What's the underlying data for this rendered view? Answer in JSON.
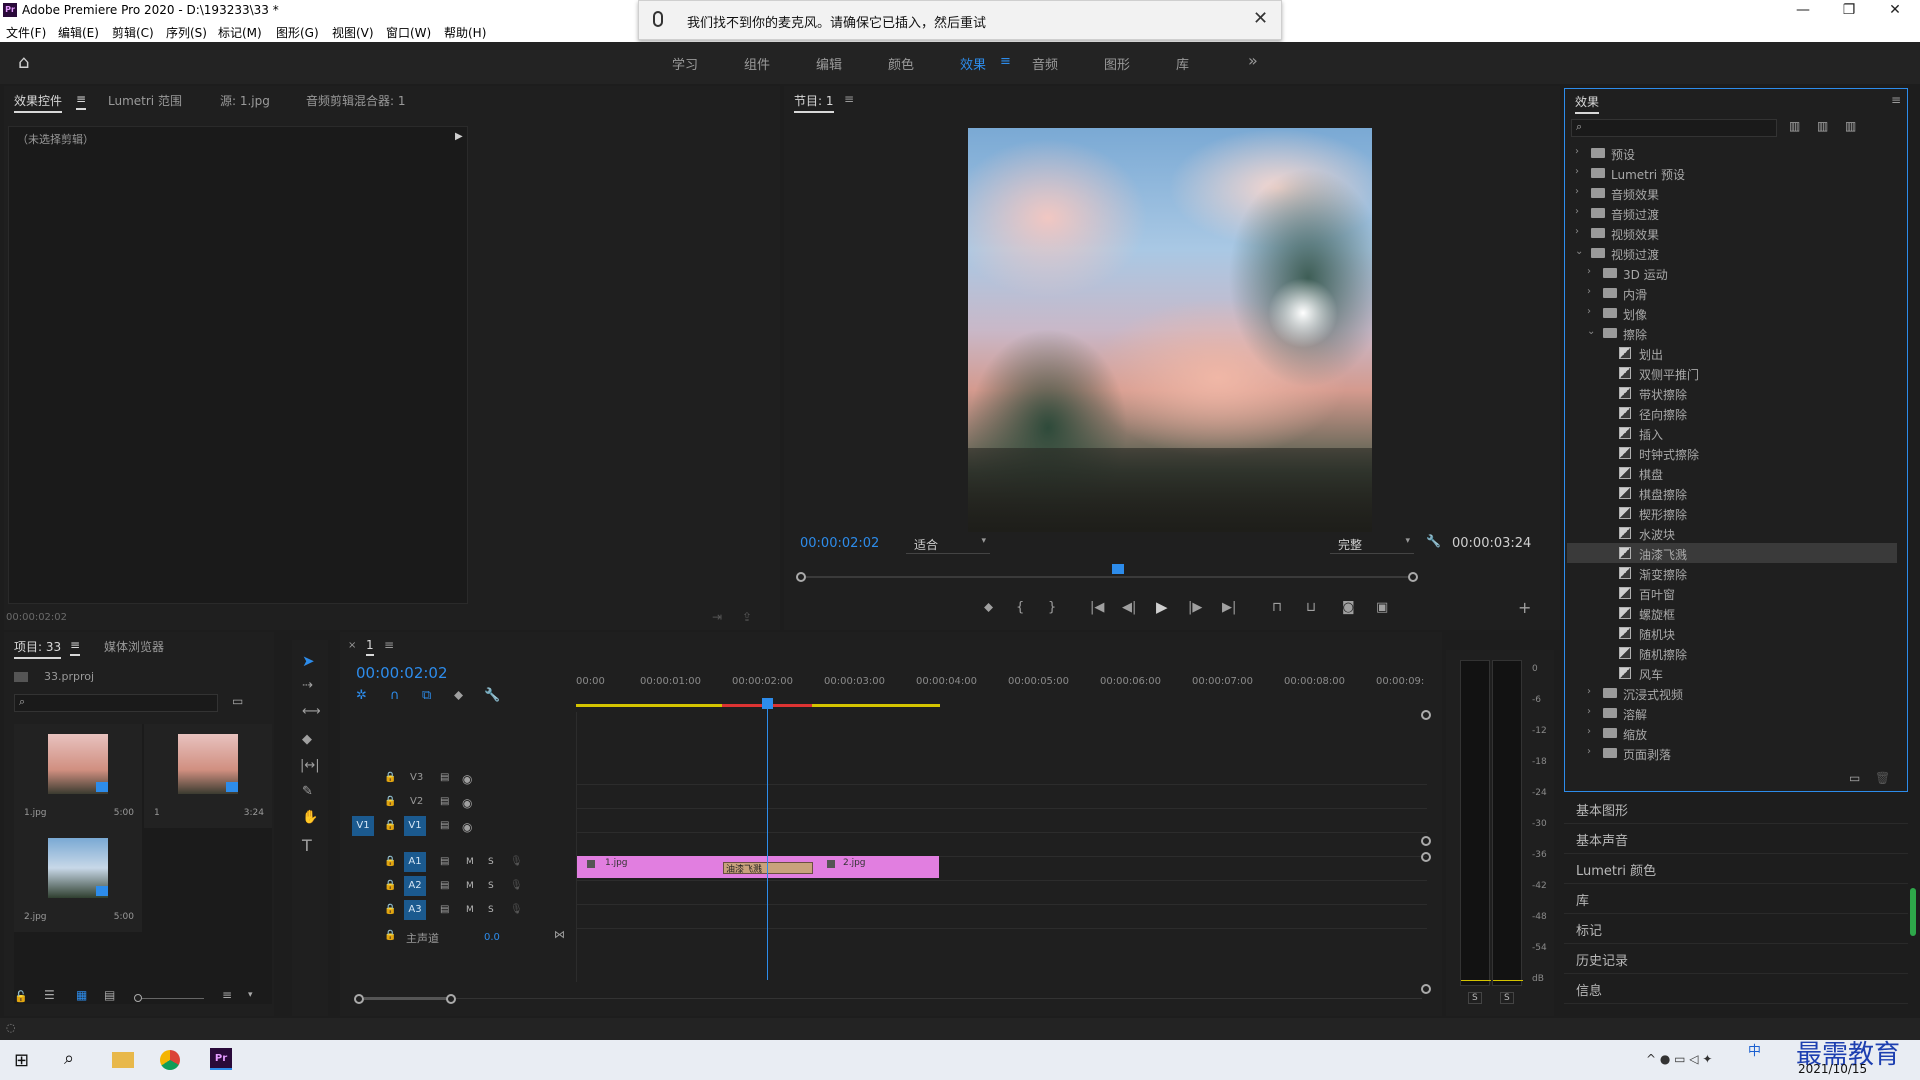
{
  "window": {
    "title": "Adobe Premiere Pro 2020 - D:\\193233\\33 *",
    "minimize": "—",
    "maximize": "❐",
    "close": "✕"
  },
  "menu": [
    "文件(F)",
    "编辑(E)",
    "剪辑(C)",
    "序列(S)",
    "标记(M)",
    "图形(G)",
    "视图(V)",
    "窗口(W)",
    "帮助(H)"
  ],
  "notification": {
    "text": "我们找不到你的麦克风。请确保它已插入，然后重试"
  },
  "workspaces": {
    "items": [
      "学习",
      "组件",
      "编辑",
      "颜色",
      "效果",
      "音频",
      "图形",
      "库"
    ],
    "active": "效果",
    "more": "»"
  },
  "source_panel": {
    "tabs": [
      "效果控件",
      "Lumetri 范围",
      "源: 1.jpg",
      "音频剪辑混合器: 1"
    ],
    "no_clip": "（未选择剪辑）",
    "timecode": "00:00:02:02"
  },
  "program": {
    "tab": "节目: 1",
    "timecode": "00:00:02:02",
    "fit": "适合",
    "quality": "完整",
    "duration": "00:00:03:24",
    "playhead_fraction": 0.52
  },
  "project": {
    "tabs": [
      "项目: 33",
      "媒体浏览器"
    ],
    "file": "33.prproj",
    "items": [
      {
        "name": "1.jpg",
        "duration": "5:00"
      },
      {
        "name": "1",
        "duration": "3:24"
      },
      {
        "name": "2.jpg",
        "duration": "5:00"
      }
    ]
  },
  "timeline": {
    "tab": "1",
    "timecode": "00:00:02:02",
    "ruler": [
      "00:00",
      "00:00:01:00",
      "00:00:02:00",
      "00:00:03:00",
      "00:00:04:00",
      "00:00:05:00",
      "00:00:06:00",
      "00:00:07:00",
      "00:00:08:00",
      "00:00:09:"
    ],
    "video_tracks": [
      "V3",
      "V2",
      "V1"
    ],
    "audio_tracks": [
      "A1",
      "A2",
      "A3"
    ],
    "source_patch": "V1",
    "master": {
      "label": "主声道",
      "value": "0.0"
    },
    "clips": {
      "clip1": "1.jpg",
      "transition": "油漆飞溅",
      "clip2": "2.jpg"
    },
    "m": "M",
    "s": "S"
  },
  "meter": {
    "scale": [
      "0",
      "-6",
      "-12",
      "-18",
      "-24",
      "-30",
      "-36",
      "-42",
      "-48",
      "-54",
      "dB"
    ],
    "solo": [
      "S",
      "S"
    ]
  },
  "effects": {
    "title": "效果",
    "tree": [
      {
        "label": "预设",
        "level": 0,
        "type": "folder-preset",
        "open": false
      },
      {
        "label": "Lumetri 预设",
        "level": 0,
        "type": "folder-preset",
        "open": false
      },
      {
        "label": "音频效果",
        "level": 0,
        "type": "folder",
        "open": false
      },
      {
        "label": "音频过渡",
        "level": 0,
        "type": "folder",
        "open": false
      },
      {
        "label": "视频效果",
        "level": 0,
        "type": "folder",
        "open": false
      },
      {
        "label": "视频过渡",
        "level": 0,
        "type": "folder",
        "open": true
      },
      {
        "label": "3D 运动",
        "level": 1,
        "type": "folder",
        "open": false
      },
      {
        "label": "内滑",
        "level": 1,
        "type": "folder",
        "open": false
      },
      {
        "label": "划像",
        "level": 1,
        "type": "folder",
        "open": false
      },
      {
        "label": "擦除",
        "level": 1,
        "type": "folder",
        "open": true
      },
      {
        "label": "划出",
        "level": 2,
        "type": "effect"
      },
      {
        "label": "双侧平推门",
        "level": 2,
        "type": "effect"
      },
      {
        "label": "带状擦除",
        "level": 2,
        "type": "effect"
      },
      {
        "label": "径向擦除",
        "level": 2,
        "type": "effect"
      },
      {
        "label": "插入",
        "level": 2,
        "type": "effect"
      },
      {
        "label": "时钟式擦除",
        "level": 2,
        "type": "effect"
      },
      {
        "label": "棋盘",
        "level": 2,
        "type": "effect"
      },
      {
        "label": "棋盘擦除",
        "level": 2,
        "type": "effect"
      },
      {
        "label": "楔形擦除",
        "level": 2,
        "type": "effect"
      },
      {
        "label": "水波块",
        "level": 2,
        "type": "effect"
      },
      {
        "label": "油漆飞溅",
        "level": 2,
        "type": "effect",
        "selected": true
      },
      {
        "label": "渐变擦除",
        "level": 2,
        "type": "effect"
      },
      {
        "label": "百叶窗",
        "level": 2,
        "type": "effect"
      },
      {
        "label": "螺旋框",
        "level": 2,
        "type": "effect"
      },
      {
        "label": "随机块",
        "level": 2,
        "type": "effect"
      },
      {
        "label": "随机擦除",
        "level": 2,
        "type": "effect"
      },
      {
        "label": "风车",
        "level": 2,
        "type": "effect"
      },
      {
        "label": "沉浸式视频",
        "level": 1,
        "type": "folder",
        "open": false
      },
      {
        "label": "溶解",
        "level": 1,
        "type": "folder",
        "open": false
      },
      {
        "label": "缩放",
        "level": 1,
        "type": "folder",
        "open": false
      },
      {
        "label": "页面剥落",
        "level": 1,
        "type": "folder",
        "open": false
      }
    ]
  },
  "side_panels": [
    "基本图形",
    "基本声音",
    "Lumetri 颜色",
    "库",
    "标记",
    "历史记录",
    "信息"
  ],
  "taskbar": {
    "date": "2021/10/15",
    "watermark": "最需教育",
    "ime": "中"
  },
  "colors": {
    "accent": "#2d8ceb",
    "clip": "#e17ee0",
    "transition": "#c9a27c",
    "track_label": "#1b5a8f"
  }
}
